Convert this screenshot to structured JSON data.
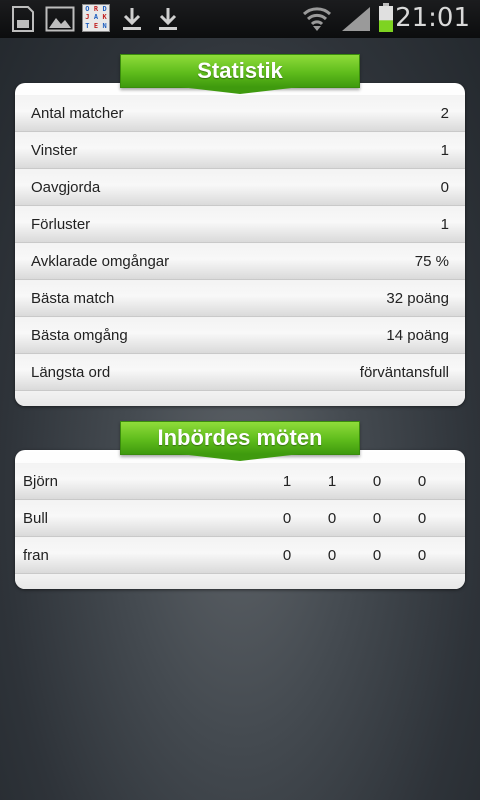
{
  "status_bar": {
    "time": "21:01",
    "app_logo": [
      "O",
      "R",
      "D",
      "J",
      "A",
      "K",
      "T",
      "E",
      "N"
    ],
    "app_logo_colors": [
      "#1f5fbf",
      "#c02020",
      "#1f5fbf",
      "#c02020",
      "#1f5fbf",
      "#c02020",
      "#1f5fbf",
      "#c02020",
      "#1f5fbf"
    ],
    "icons": [
      "sd-card-icon",
      "image-icon",
      "ordjakten-app-icon",
      "download-icon",
      "download-icon",
      "wifi-icon",
      "signal-icon",
      "battery-icon"
    ]
  },
  "statistik": {
    "title": "Statistik",
    "rows": [
      {
        "label": "Antal matcher",
        "value": "2"
      },
      {
        "label": "Vinster",
        "value": "1"
      },
      {
        "label": "Oavgjorda",
        "value": "0"
      },
      {
        "label": "Förluster",
        "value": "1"
      },
      {
        "label": "Avklarade omgångar",
        "value": "75 %"
      },
      {
        "label": "Bästa match",
        "value": "32 poäng"
      },
      {
        "label": "Bästa omgång",
        "value": "14 poäng"
      },
      {
        "label": "Längsta ord",
        "value": "förväntansfull"
      }
    ]
  },
  "inbordes": {
    "title": "Inbördes möten",
    "rows": [
      {
        "name": "Björn",
        "values": [
          "1",
          "1",
          "0",
          "0"
        ]
      },
      {
        "name": "Bull",
        "values": [
          "0",
          "0",
          "0",
          "0"
        ]
      },
      {
        "name": "fran",
        "values": [
          "0",
          "0",
          "0",
          "0"
        ]
      }
    ]
  },
  "colors": {
    "banner_green": "#5fbc1c",
    "battery_level": "#7ed321"
  },
  "battery_level_fraction": 0.45
}
